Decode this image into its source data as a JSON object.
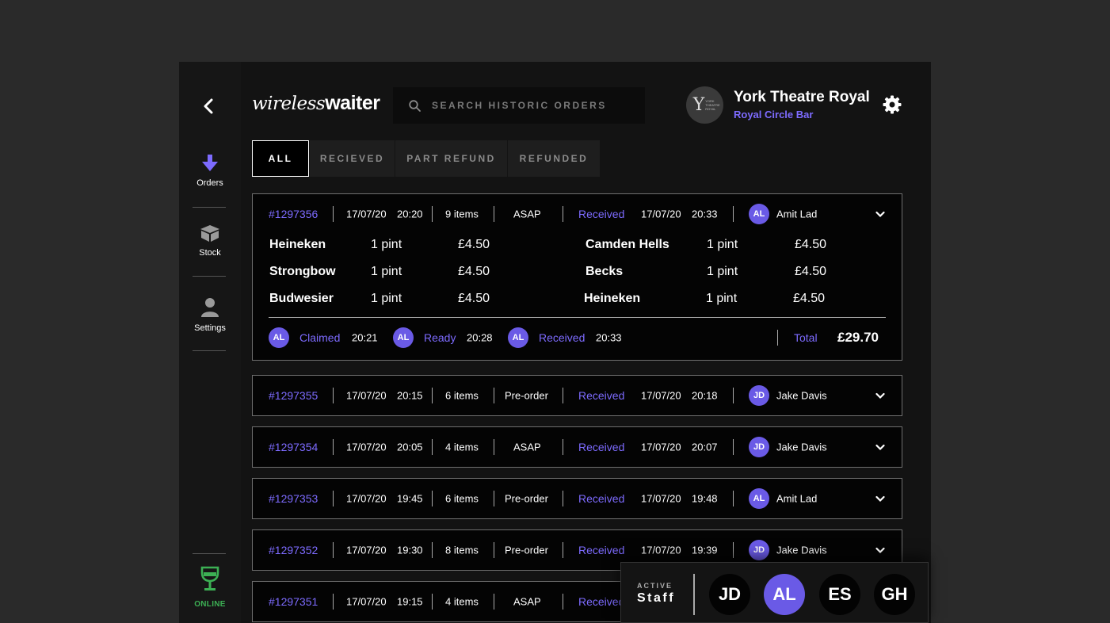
{
  "sidebar": {
    "nav": [
      {
        "label": "Orders",
        "icon": "arrow-down-icon",
        "active": true
      },
      {
        "label": "Stock",
        "icon": "box-icon"
      },
      {
        "label": "Settings",
        "icon": "user-icon"
      }
    ],
    "status_label": "ONLINE"
  },
  "header": {
    "logo_light": "wireless",
    "logo_bold": "waiter",
    "search_placeholder": "SEARCH HISTORIC ORDERS",
    "venue_name": "York Theatre Royal",
    "venue_sub": "Royal Circle Bar",
    "venue_avatar_letter": "Y",
    "venue_avatar_text": "YORK THEATRE ROYAL"
  },
  "tabs": [
    {
      "label": "ALL",
      "active": true
    },
    {
      "label": "RECIEVED"
    },
    {
      "label": "PART REFUND"
    },
    {
      "label": "REFUNDED"
    }
  ],
  "orders": [
    {
      "id": "#1297356",
      "date": "17/07/20",
      "time": "20:20",
      "items": "9 items",
      "type": "ASAP",
      "status": "Received",
      "status_date": "17/07/20",
      "status_time": "20:33",
      "staff_initials": "AL",
      "staff_name": "Amit Lad",
      "lines": [
        {
          "name": "Heineken",
          "qty": "1 pint",
          "price": "£4.50"
        },
        {
          "name": "Strongbow",
          "qty": "1 pint",
          "price": "£4.50"
        },
        {
          "name": "Budwesier",
          "qty": "1 pint",
          "price": "£4.50"
        },
        {
          "name": "Camden Hells",
          "qty": "1 pint",
          "price": "£4.50"
        },
        {
          "name": "Becks",
          "qty": "1 pint",
          "price": "£4.50"
        },
        {
          "name": "Heineken",
          "qty": "1 pint",
          "price": "£4.50"
        }
      ],
      "timeline": [
        {
          "initials": "AL",
          "label": "Claimed",
          "time": "20:21"
        },
        {
          "initials": "AL",
          "label": "Ready",
          "time": "20:28"
        },
        {
          "initials": "AL",
          "label": "Received",
          "time": "20:33"
        }
      ],
      "total_label": "Total",
      "total": "£29.70"
    },
    {
      "id": "#1297355",
      "date": "17/07/20",
      "time": "20:15",
      "items": "6 items",
      "type": "Pre-order",
      "status": "Received",
      "status_date": "17/07/20",
      "status_time": "20:18",
      "staff_initials": "JD",
      "staff_name": "Jake Davis"
    },
    {
      "id": "#1297354",
      "date": "17/07/20",
      "time": "20:05",
      "items": "4 items",
      "type": "ASAP",
      "status": "Received",
      "status_date": "17/07/20",
      "status_time": "20:07",
      "staff_initials": "JD",
      "staff_name": "Jake Davis"
    },
    {
      "id": "#1297353",
      "date": "17/07/20",
      "time": "19:45",
      "items": "6 items",
      "type": "Pre-order",
      "status": "Received",
      "status_date": "17/07/20",
      "status_time": "19:48",
      "staff_initials": "AL",
      "staff_name": "Amit Lad"
    },
    {
      "id": "#1297352",
      "date": "17/07/20",
      "time": "19:30",
      "items": "8 items",
      "type": "Pre-order",
      "status": "Received",
      "status_date": "17/07/20",
      "status_time": "19:39",
      "staff_initials": "JD",
      "staff_name": "Jake Davis"
    },
    {
      "id": "#1297351",
      "date": "17/07/20",
      "time": "19:15",
      "items": "4 items",
      "type": "ASAP",
      "status": "Received",
      "status_date": "",
      "status_time": "",
      "staff_initials": "",
      "staff_name": ""
    }
  ],
  "staff_panel": {
    "active_label": "ACTIVE",
    "staff_label": "Staff",
    "members": [
      {
        "initials": "JD",
        "active": false
      },
      {
        "initials": "AL",
        "active": true
      },
      {
        "initials": "ES",
        "active": false
      },
      {
        "initials": "GH",
        "active": false
      }
    ]
  },
  "colors": {
    "accent": "#7d6bff",
    "avatar": "#6a5ae6",
    "online": "#3cb054",
    "background": "#131313"
  }
}
